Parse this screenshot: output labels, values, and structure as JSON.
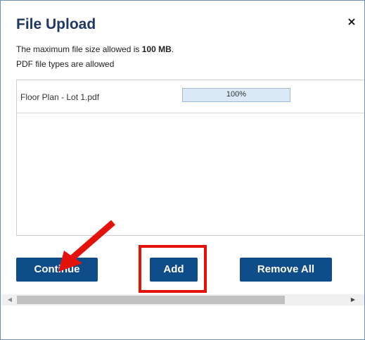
{
  "dialog": {
    "title": "File Upload",
    "close_symbol": "×",
    "info": {
      "max_size_prefix": "The maximum file size allowed is ",
      "max_size_value": "100 MB",
      "max_size_suffix": ".",
      "file_types": "PDF file types are allowed"
    }
  },
  "files": [
    {
      "name": "Floor Plan - Lot 1.pdf",
      "progress_label": "100%",
      "progress_fraction": 1.0
    }
  ],
  "buttons": {
    "continue": "Continue",
    "add": "Add",
    "remove_all": "Remove All"
  },
  "scrollbar": {
    "left_arrow": "◀",
    "right_arrow": "▶"
  },
  "colors": {
    "title": "#1f3864",
    "button_bg": "#0f4c8a",
    "annotation_red": "#e3120b",
    "progress_fill": "#dbe9f7"
  },
  "icons": {
    "close": "close-icon",
    "annotation_arrow": "red-arrow-icon"
  }
}
